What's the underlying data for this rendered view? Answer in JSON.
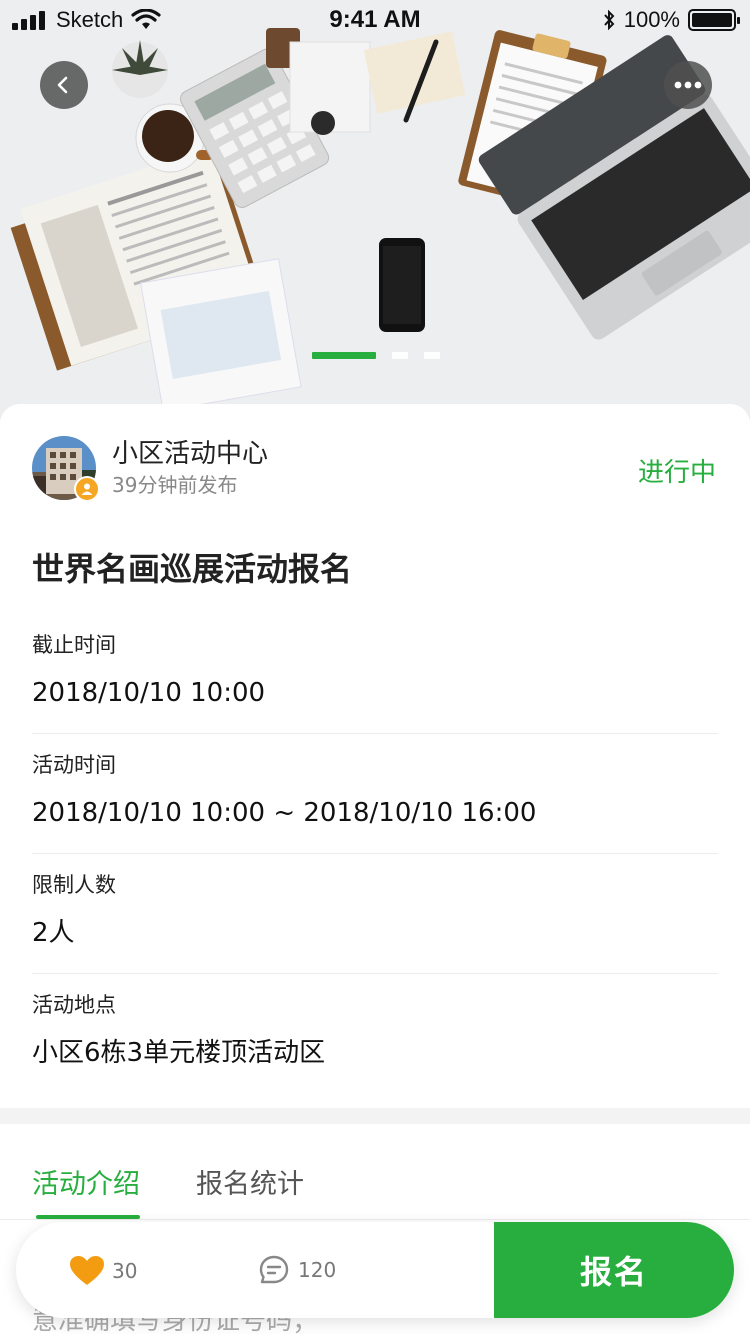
{
  "status_bar": {
    "carrier": "Sketch",
    "time": "9:41 AM",
    "battery": "100%",
    "battery_level": 1.0
  },
  "hero": {
    "carousel_pages": 3,
    "active_page": 0,
    "icons": {
      "back": "chevron-left-icon",
      "more": "more-dots-icon"
    }
  },
  "publisher": {
    "name": "小区活动中心",
    "time_ago": "39分钟前发布",
    "status": "进行中"
  },
  "event": {
    "title": "世界名画巡展活动报名",
    "fields": [
      {
        "label": "截止时间",
        "value": "2018/10/10 10:00"
      },
      {
        "label": "活动时间",
        "value": "2018/10/10 10:00 ~ 2018/10/10 16:00"
      },
      {
        "label": "限制人数",
        "value": "2人"
      },
      {
        "label": "活动地点",
        "value": "小区6栋3单元楼顶活动区"
      }
    ]
  },
  "tabs": [
    {
      "label": "活动介绍",
      "active": true
    },
    {
      "label": "报名统计",
      "active": false
    }
  ],
  "peek_text": "意准确填写身份证号码；",
  "action_bar": {
    "likes": "30",
    "comments": "120",
    "signup_label": "报名",
    "icons": {
      "like": "heart-icon",
      "comment": "comment-icon"
    }
  },
  "colors": {
    "accent_green": "#27ae3e",
    "badge_orange": "#f5a623",
    "heart_orange": "#f39c12"
  }
}
